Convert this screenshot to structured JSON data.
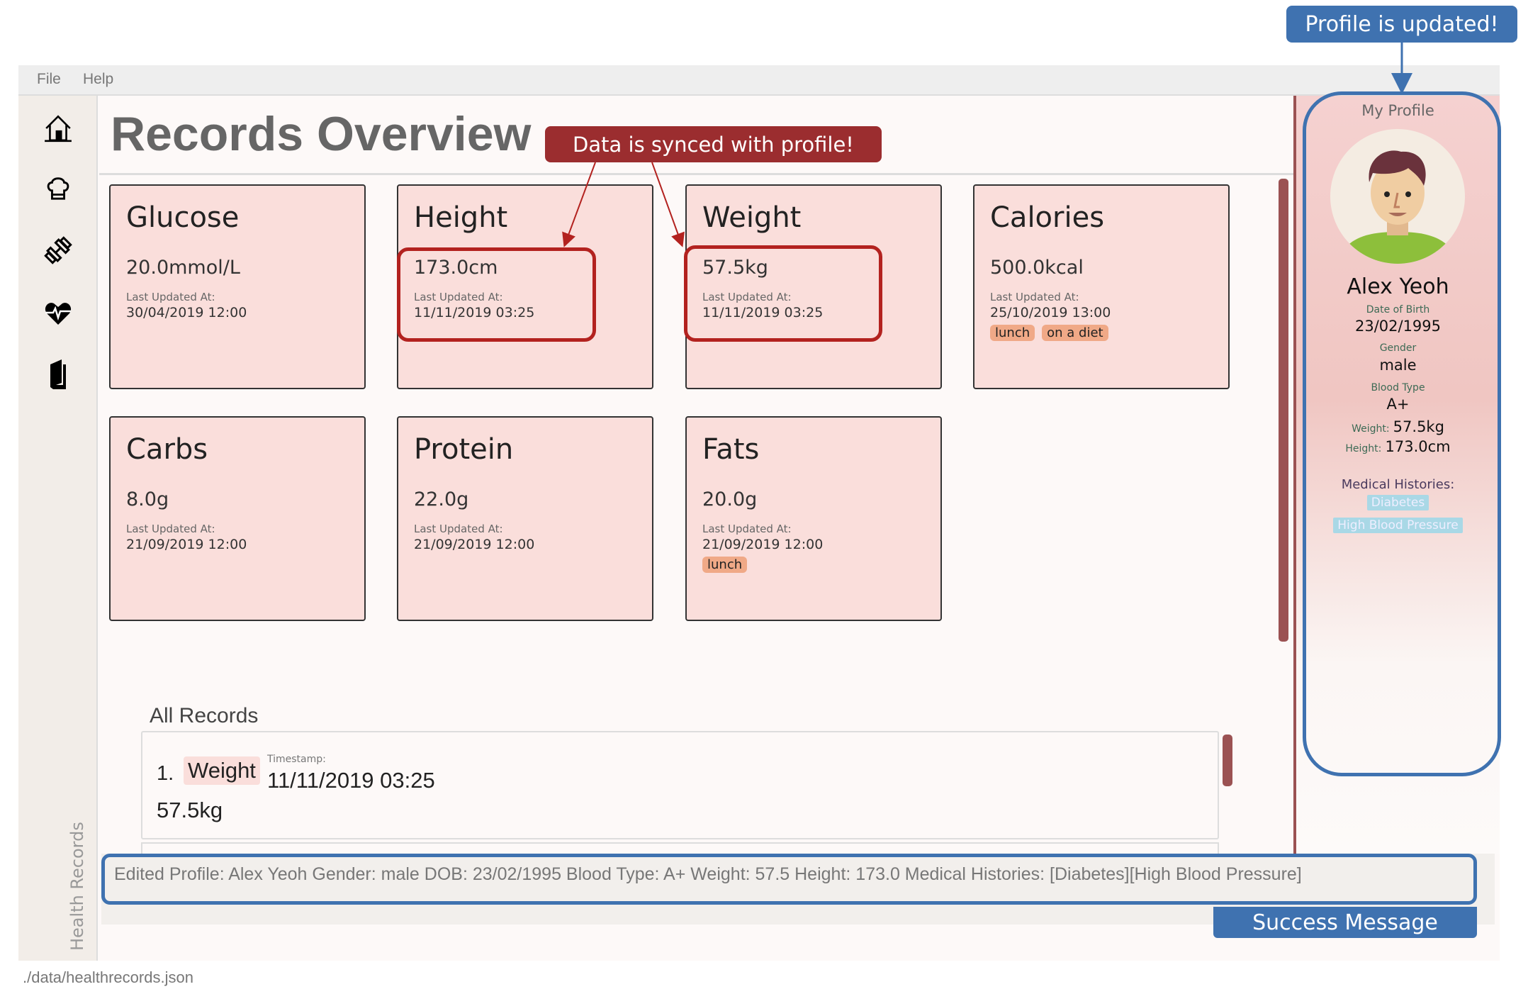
{
  "menu": {
    "file": "File",
    "help": "Help"
  },
  "sidebar": {
    "icons": [
      "home-icon",
      "chef-hat-icon",
      "dumbbell-icon",
      "heartbeat-icon",
      "book-icon"
    ],
    "vertical_label": "Health Records"
  },
  "main": {
    "title": "Records Overview",
    "cards": [
      {
        "title": "Glucose",
        "value": "20.0mmol/L",
        "updated_label": "Last Updated At:",
        "updated": "30/04/2019 12:00",
        "tags": []
      },
      {
        "title": "Height",
        "value": "173.0cm",
        "updated_label": "Last Updated At:",
        "updated": "11/11/2019 03:25",
        "tags": []
      },
      {
        "title": "Weight",
        "value": "57.5kg",
        "updated_label": "Last Updated At:",
        "updated": "11/11/2019 03:25",
        "tags": []
      },
      {
        "title": "Calories",
        "value": "500.0kcal",
        "updated_label": "Last Updated At:",
        "updated": "25/10/2019 13:00",
        "tags": [
          "lunch",
          "on a diet"
        ]
      },
      {
        "title": "Carbs",
        "value": "8.0g",
        "updated_label": "Last Updated At:",
        "updated": "21/09/2019 12:00",
        "tags": []
      },
      {
        "title": "Protein",
        "value": "22.0g",
        "updated_label": "Last Updated At:",
        "updated": "21/09/2019 12:00",
        "tags": []
      },
      {
        "title": "Fats",
        "value": "20.0g",
        "updated_label": "Last Updated At:",
        "updated": "21/09/2019 12:00",
        "tags": [
          "lunch"
        ]
      }
    ],
    "all_records": {
      "heading": "All Records",
      "items": [
        {
          "index": "1.",
          "type": "Weight",
          "timestamp_label": "Timestamp:",
          "timestamp": "11/11/2019 03:25",
          "value": "57.5kg"
        }
      ]
    }
  },
  "profile": {
    "heading": "My Profile",
    "name": "Alex Yeoh",
    "dob_label": "Date of Birth",
    "dob": "23/02/1995",
    "gender_label": "Gender",
    "gender": "male",
    "blood_label": "Blood Type",
    "blood": "A+",
    "weight_label": "Weight:",
    "weight": "57.5kg",
    "height_label": "Height:",
    "height": "173.0cm",
    "histories_label": "Medical Histories:",
    "histories": [
      "Diabetes",
      "High Blood Pressure"
    ]
  },
  "result": "Edited Profile: Alex Yeoh Gender: male DOB: 23/02/1995 Blood Type: A+ Weight: 57.5 Height: 173.0 Medical Histories: [Diabetes][High Blood Pressure]",
  "status_bar": "./data/healthrecords.json",
  "annotations": {
    "profile_updated": "Profile is updated!",
    "data_synced": "Data is synced with profile!",
    "success": "Success Message"
  },
  "colors": {
    "annotation_blue": "#3f72b0",
    "annotation_red": "#9b2d2f",
    "highlight_red": "#b3221f",
    "card_bg": "#fadedb",
    "tag": "#f0a987",
    "scrollbar": "#9b5253"
  }
}
